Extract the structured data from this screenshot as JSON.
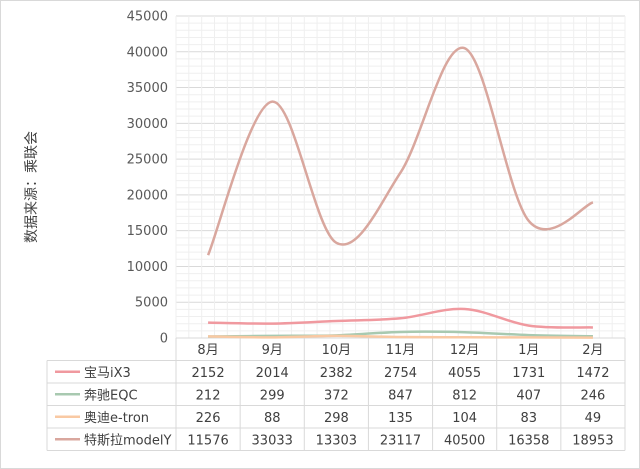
{
  "chart_data": {
    "type": "line",
    "ylabel": "数据来源：乘联会",
    "ylim": [
      0,
      45000
    ],
    "yticks": [
      0,
      5000,
      10000,
      15000,
      20000,
      25000,
      30000,
      35000,
      40000,
      45000
    ],
    "categories": [
      "8月",
      "9月",
      "10月",
      "11月",
      "12月",
      "1月",
      "2月"
    ],
    "series": [
      {
        "name": "宝马iX3",
        "values": [
          2152,
          2014,
          2382,
          2754,
          4055,
          1731,
          1472
        ],
        "color": "#f0999f"
      },
      {
        "name": "奔驰EQC",
        "values": [
          212,
          299,
          372,
          847,
          812,
          407,
          246
        ],
        "color": "#a8c9b0"
      },
      {
        "name": "奥迪e-tron",
        "values": [
          226,
          88,
          298,
          135,
          104,
          83,
          49
        ],
        "color": "#f9c9a3"
      },
      {
        "name": "特斯拉modelY",
        "values": [
          11576,
          33033,
          13303,
          23117,
          40500,
          16358,
          18953
        ],
        "color": "#d9a79e"
      }
    ],
    "grid": true,
    "legend": "data-table"
  }
}
